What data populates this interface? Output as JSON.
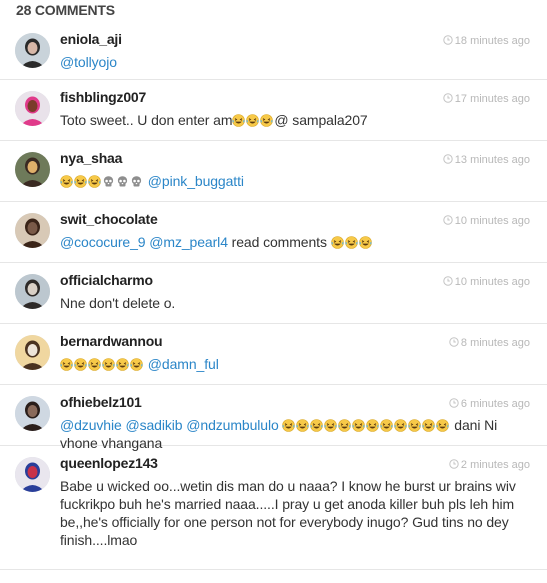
{
  "header": {
    "count_label": "28 COMMENTS"
  },
  "comments": [
    {
      "username": "eniola_aji",
      "time": "18 minutes ago",
      "segments": [
        {
          "type": "mention",
          "text": "@tollyojo"
        }
      ],
      "avatar_colors": [
        "#c9d3da",
        "#2a2a2a",
        "#d7b7a7"
      ]
    },
    {
      "username": "fishblingz007",
      "time": "17 minutes ago",
      "segments": [
        {
          "type": "text",
          "text": "Toto sweet.. U don enter am"
        },
        {
          "type": "emoji",
          "name": "laughing-emoji"
        },
        {
          "type": "emoji",
          "name": "laughing-emoji"
        },
        {
          "type": "emoji",
          "name": "laughing-emoji"
        },
        {
          "type": "text",
          "text": "@ sampala207"
        }
      ],
      "avatar_colors": [
        "#e9e2ea",
        "#e03a8a",
        "#7a3b2a"
      ]
    },
    {
      "username": "nya_shaa",
      "time": "13 minutes ago",
      "segments": [
        {
          "type": "emoji",
          "name": "laughing-emoji"
        },
        {
          "type": "emoji",
          "name": "laughing-emoji"
        },
        {
          "type": "emoji",
          "name": "laughing-emoji"
        },
        {
          "type": "emoji",
          "name": "skull-emoji"
        },
        {
          "type": "emoji",
          "name": "skull-emoji"
        },
        {
          "type": "emoji",
          "name": "skull-emoji"
        },
        {
          "type": "text",
          "text": " "
        },
        {
          "type": "mention",
          "text": "@pink_buggatti"
        }
      ],
      "avatar_colors": [
        "#6e7a5a",
        "#3a2a22",
        "#e0b06a"
      ]
    },
    {
      "username": "swit_chocolate",
      "time": "10 minutes ago",
      "segments": [
        {
          "type": "mention",
          "text": "@cococure_9"
        },
        {
          "type": "text",
          "text": " "
        },
        {
          "type": "mention",
          "text": "@mz_pearl4"
        },
        {
          "type": "text",
          "text": " read comments "
        },
        {
          "type": "emoji",
          "name": "laughing-emoji"
        },
        {
          "type": "emoji",
          "name": "laughing-emoji"
        },
        {
          "type": "emoji",
          "name": "laughing-emoji"
        }
      ],
      "avatar_colors": [
        "#d8c9b6",
        "#3a2418",
        "#7a5a48"
      ]
    },
    {
      "username": "officialcharmo",
      "time": "10 minutes ago",
      "segments": [
        {
          "type": "text",
          "text": "Nne don't delete o."
        }
      ],
      "avatar_colors": [
        "#bcc7cf",
        "#2e2a28",
        "#d9d0c6"
      ]
    },
    {
      "username": "bernardwannou",
      "time": "8 minutes ago",
      "segments": [
        {
          "type": "emoji",
          "name": "laughing-emoji"
        },
        {
          "type": "emoji",
          "name": "laughing-emoji"
        },
        {
          "type": "emoji",
          "name": "laughing-emoji"
        },
        {
          "type": "emoji",
          "name": "laughing-emoji"
        },
        {
          "type": "emoji",
          "name": "laughing-emoji"
        },
        {
          "type": "emoji",
          "name": "laughing-emoji"
        },
        {
          "type": "text",
          "text": " "
        },
        {
          "type": "mention",
          "text": "@damn_ful"
        }
      ],
      "avatar_colors": [
        "#f0d7a0",
        "#4a3220",
        "#ede4d8"
      ]
    },
    {
      "username": "ofhiebelz101",
      "time": "6 minutes ago",
      "segments": [
        {
          "type": "mention",
          "text": "@dzuvhie"
        },
        {
          "type": "text",
          "text": " "
        },
        {
          "type": "mention",
          "text": "@sadikib"
        },
        {
          "type": "text",
          "text": " "
        },
        {
          "type": "mention",
          "text": "@ndzumbululo"
        },
        {
          "type": "text",
          "text": " "
        },
        {
          "type": "emoji",
          "name": "laughing-emoji"
        },
        {
          "type": "emoji",
          "name": "laughing-emoji"
        },
        {
          "type": "emoji",
          "name": "laughing-emoji"
        },
        {
          "type": "emoji",
          "name": "laughing-emoji"
        },
        {
          "type": "emoji",
          "name": "laughing-emoji"
        },
        {
          "type": "emoji",
          "name": "laughing-emoji"
        },
        {
          "type": "emoji",
          "name": "laughing-emoji"
        },
        {
          "type": "emoji",
          "name": "laughing-emoji"
        },
        {
          "type": "emoji",
          "name": "laughing-emoji"
        },
        {
          "type": "emoji",
          "name": "laughing-emoji"
        },
        {
          "type": "emoji",
          "name": "laughing-emoji"
        },
        {
          "type": "emoji",
          "name": "laughing-emoji"
        },
        {
          "type": "text",
          "text": " dani Ni vhone vhangana"
        }
      ],
      "avatar_colors": [
        "#cfd8e2",
        "#2a1e1a",
        "#8a6a5a"
      ]
    },
    {
      "username": "queenlopez143",
      "time": "2 minutes ago",
      "segments": [
        {
          "type": "text",
          "text": "Babe u wicked oo...wetin dis man do u naaa? I know he burst ur brains wiv fuckrikpo buh he's married naaa.....I pray u get anoda killer buh pls leh him be,,he's officially for one person not for everybody inugo? Gud tins no dey finish....lmao"
        }
      ],
      "avatar_colors": [
        "#e9e6ee",
        "#2a3f9a",
        "#c8324a"
      ]
    }
  ],
  "layout_rows": [
    58,
    61,
    61,
    61,
    61,
    61,
    61,
    120
  ],
  "colors": {
    "mention": "#2b86c8",
    "time": "#b8b8b8",
    "divider": "#e6e6e6",
    "emoji_face": "#f7c948",
    "skull": "#9a9a9a"
  }
}
